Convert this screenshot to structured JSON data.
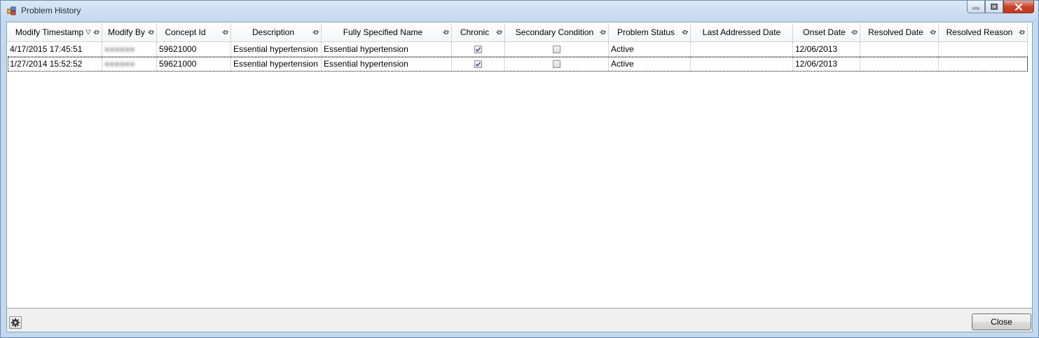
{
  "window": {
    "title": "Problem History"
  },
  "grid": {
    "columns": [
      {
        "label": "Modify Timestamp",
        "sorted": "descending"
      },
      {
        "label": "Modify By"
      },
      {
        "label": "Concept Id"
      },
      {
        "label": "Description"
      },
      {
        "label": "Fully Specified Name"
      },
      {
        "label": "Chronic"
      },
      {
        "label": "Secondary Condition"
      },
      {
        "label": "Problem Status"
      },
      {
        "label": "Last Addressed Date"
      },
      {
        "label": "Onset Date"
      },
      {
        "label": "Resolved Date"
      },
      {
        "label": "Resolved Reason"
      }
    ],
    "rows": [
      {
        "modify_timestamp": "4/17/2015 17:45:51",
        "modify_by": "●●●●●●",
        "concept_id": "59621000",
        "description": "Essential hypertension",
        "fully_specified_name": "Essential hypertension",
        "chronic": true,
        "secondary_condition": false,
        "problem_status": "Active",
        "last_addressed_date": "",
        "onset_date": "12/06/2013",
        "resolved_date": "",
        "resolved_reason": ""
      },
      {
        "modify_timestamp": "1/27/2014 15:52:52",
        "modify_by": "●●●●●●",
        "concept_id": "59621000",
        "description": "Essential hypertension",
        "fully_specified_name": "Essential hypertension",
        "chronic": true,
        "secondary_condition": false,
        "problem_status": "Active",
        "last_addressed_date": "",
        "onset_date": "12/06/2013",
        "resolved_date": "",
        "resolved_reason": ""
      }
    ]
  },
  "footer": {
    "close_label": "Close",
    "settings_icon": "gear-icon"
  },
  "colors": {
    "titlebar": "#c3d7ee",
    "close_window": "#c8422b"
  }
}
